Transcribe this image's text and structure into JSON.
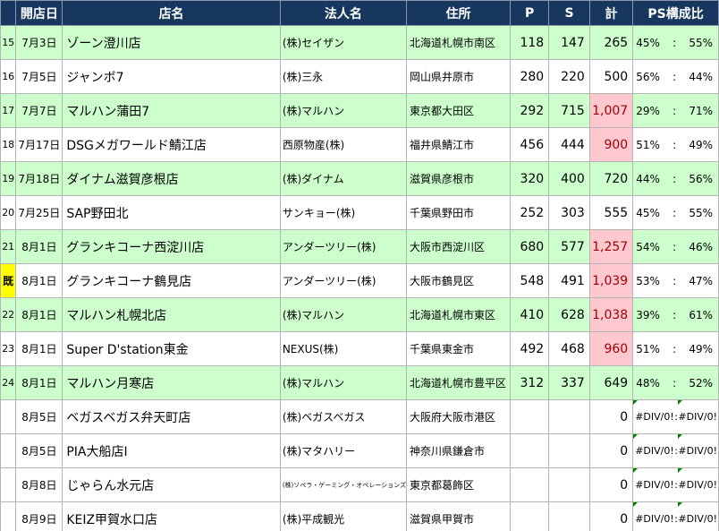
{
  "headers": [
    "開店日",
    "店名",
    "法人名",
    "住所",
    "P",
    "S",
    "計",
    "PS構成比"
  ],
  "rows": [
    {
      "no": "15",
      "date": "7月3日",
      "store": "ゾーン澄川店",
      "corp": "(株)セイザン",
      "addr": "北海道札幌市南区",
      "p": "118",
      "s": "147",
      "total": "265",
      "p_pct": "45%",
      "sep": ":",
      "s_pct": "55%",
      "green": true,
      "hi": false
    },
    {
      "no": "16",
      "date": "7月5日",
      "store": "ジャンボ7",
      "corp": "(株)三永",
      "addr": "岡山県井原市",
      "p": "280",
      "s": "220",
      "total": "500",
      "p_pct": "56%",
      "sep": ":",
      "s_pct": "44%",
      "green": false,
      "hi": false
    },
    {
      "no": "17",
      "date": "7月7日",
      "store": "マルハン蒲田7",
      "corp": "(株)マルハン",
      "addr": "東京都大田区",
      "p": "292",
      "s": "715",
      "total": "1,007",
      "p_pct": "29%",
      "sep": ":",
      "s_pct": "71%",
      "green": true,
      "hi": true
    },
    {
      "no": "18",
      "date": "7月17日",
      "store": "DSGメガワールド鯖江店",
      "corp": "西原物産(株)",
      "addr": "福井県鯖江市",
      "p": "456",
      "s": "444",
      "total": "900",
      "p_pct": "51%",
      "sep": ":",
      "s_pct": "49%",
      "green": false,
      "hi": true
    },
    {
      "no": "19",
      "date": "7月18日",
      "store": "ダイナム滋賀彦根店",
      "corp": "(株)ダイナム",
      "addr": "滋賀県彦根市",
      "p": "320",
      "s": "400",
      "total": "720",
      "p_pct": "44%",
      "sep": ":",
      "s_pct": "56%",
      "green": true,
      "hi": false
    },
    {
      "no": "20",
      "date": "7月25日",
      "store": "SAP野田北",
      "corp": "サンキョー(株)",
      "addr": "千葉県野田市",
      "p": "252",
      "s": "303",
      "total": "555",
      "p_pct": "45%",
      "sep": ":",
      "s_pct": "55%",
      "green": false,
      "hi": false
    },
    {
      "no": "21",
      "date": "8月1日",
      "store": "グランキコーナ西淀川店",
      "corp": "アンダーツリー(株)",
      "addr": "大阪市西淀川区",
      "p": "680",
      "s": "577",
      "total": "1,257",
      "p_pct": "54%",
      "sep": ":",
      "s_pct": "46%",
      "green": true,
      "hi": true
    },
    {
      "no": "既",
      "date": "8月1日",
      "store": "グランキコーナ鶴見店",
      "corp": "アンダーツリー(株)",
      "addr": "大阪市鶴見区",
      "p": "548",
      "s": "491",
      "total": "1,039",
      "p_pct": "53%",
      "sep": ":",
      "s_pct": "47%",
      "green": false,
      "hi": true,
      "kisetsu": true
    },
    {
      "no": "22",
      "date": "8月1日",
      "store": "マルハン札幌北店",
      "corp": "(株)マルハン",
      "addr": "北海道札幌市東区",
      "p": "410",
      "s": "628",
      "total": "1,038",
      "p_pct": "39%",
      "sep": ":",
      "s_pct": "61%",
      "green": true,
      "hi": true
    },
    {
      "no": "23",
      "date": "8月1日",
      "store": "Super D'station東金",
      "corp": "NEXUS(株)",
      "addr": "千葉県東金市",
      "p": "492",
      "s": "468",
      "total": "960",
      "p_pct": "51%",
      "sep": ":",
      "s_pct": "49%",
      "green": false,
      "hi": true
    },
    {
      "no": "24",
      "date": "8月1日",
      "store": "マルハン月寒店",
      "corp": "(株)マルハン",
      "addr": "北海道札幌市豊平区",
      "p": "312",
      "s": "337",
      "total": "649",
      "p_pct": "48%",
      "sep": ":",
      "s_pct": "52%",
      "green": true,
      "hi": false
    },
    {
      "no": "",
      "date": "8月5日",
      "store": "ベガスベガス弁天町店",
      "corp": "(株)ベガスベガス",
      "addr": "大阪府大阪市港区",
      "p": "",
      "s": "",
      "total": "0",
      "p_pct": "#DIV/0!",
      "sep": ":",
      "s_pct": "#DIV/0!",
      "green": false,
      "hi": false,
      "err": true
    },
    {
      "no": "",
      "date": "8月5日",
      "store": "PIA大船店Ⅰ",
      "corp": "(株)マタハリー",
      "addr": "神奈川県鎌倉市",
      "p": "",
      "s": "",
      "total": "0",
      "p_pct": "#DIV/0!",
      "sep": ":",
      "s_pct": "#DIV/0!",
      "green": false,
      "hi": false,
      "err": true
    },
    {
      "no": "",
      "date": "8月8日",
      "store": "じゃらん水元店",
      "corp": "(株)ソペラ・ゲーミング・オペレーションズ",
      "addr": "東京都葛飾区",
      "p": "",
      "s": "",
      "total": "0",
      "p_pct": "#DIV/0!",
      "sep": ":",
      "s_pct": "#DIV/0!",
      "green": false,
      "hi": false,
      "err": true,
      "tiny": true
    },
    {
      "no": "",
      "date": "8月9日",
      "store": "KEIZ甲賀水口店",
      "corp": "(株)平成観光",
      "addr": "滋賀県甲賀市",
      "p": "",
      "s": "",
      "total": "0",
      "p_pct": "#DIV/0!",
      "sep": ":",
      "s_pct": "#DIV/0!",
      "green": false,
      "hi": false,
      "err": true
    }
  ],
  "colors": {
    "header_bg": "#17375e",
    "green_row": "#ccffcc",
    "highlight_bg": "#ffc7ce",
    "highlight_text": "#9c0006",
    "kisetsu_bg": "#ffff00"
  }
}
